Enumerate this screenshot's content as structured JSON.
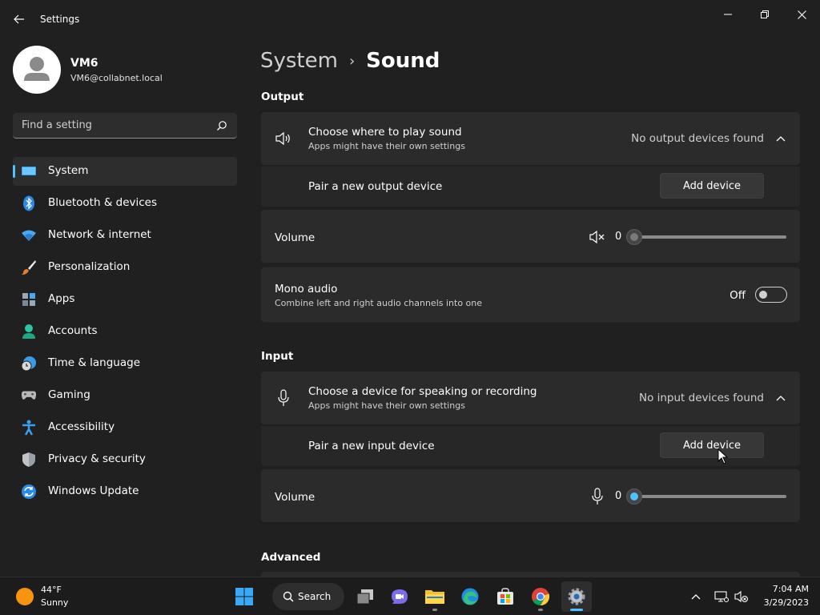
{
  "window": {
    "title": "Settings"
  },
  "profile": {
    "name": "VM6",
    "email": "VM6@collabnet.local"
  },
  "search": {
    "placeholder": "Find a setting"
  },
  "sidebar": {
    "items": [
      {
        "label": "System",
        "icon": "system-icon",
        "selected": true
      },
      {
        "label": "Bluetooth & devices",
        "icon": "bluetooth-icon"
      },
      {
        "label": "Network & internet",
        "icon": "wifi-icon"
      },
      {
        "label": "Personalization",
        "icon": "brush-icon"
      },
      {
        "label": "Apps",
        "icon": "apps-icon"
      },
      {
        "label": "Accounts",
        "icon": "account-icon"
      },
      {
        "label": "Time & language",
        "icon": "clock-globe-icon"
      },
      {
        "label": "Gaming",
        "icon": "gamepad-icon"
      },
      {
        "label": "Accessibility",
        "icon": "accessibility-icon"
      },
      {
        "label": "Privacy & security",
        "icon": "shield-icon"
      },
      {
        "label": "Windows Update",
        "icon": "update-icon"
      }
    ]
  },
  "breadcrumb": {
    "parent": "System",
    "separator": "›",
    "current": "Sound"
  },
  "output": {
    "section_title": "Output",
    "choose_title": "Choose where to play sound",
    "choose_sub": "Apps might have their own settings",
    "no_devices": "No output devices found",
    "pair_label": "Pair a new output device",
    "add_device": "Add device",
    "volume_label": "Volume",
    "volume_value": "0",
    "volume_level": 0,
    "mono_title": "Mono audio",
    "mono_sub": "Combine left and right audio channels into one",
    "mono_state": "Off"
  },
  "input": {
    "section_title": "Input",
    "choose_title": "Choose a device for speaking or recording",
    "choose_sub": "Apps might have their own settings",
    "no_devices": "No input devices found",
    "pair_label": "Pair a new input device",
    "add_device": "Add device",
    "volume_label": "Volume",
    "volume_value": "0",
    "volume_level": 0
  },
  "advanced": {
    "section_title": "Advanced"
  },
  "taskbar": {
    "weather_temp": "44°F",
    "weather_condition": "Sunny",
    "search_label": "Search",
    "time": "7:04 AM",
    "date": "3/29/2023"
  },
  "colors": {
    "accent": "#4cc2ff",
    "background": "#202020",
    "card": "#2b2b2b"
  }
}
